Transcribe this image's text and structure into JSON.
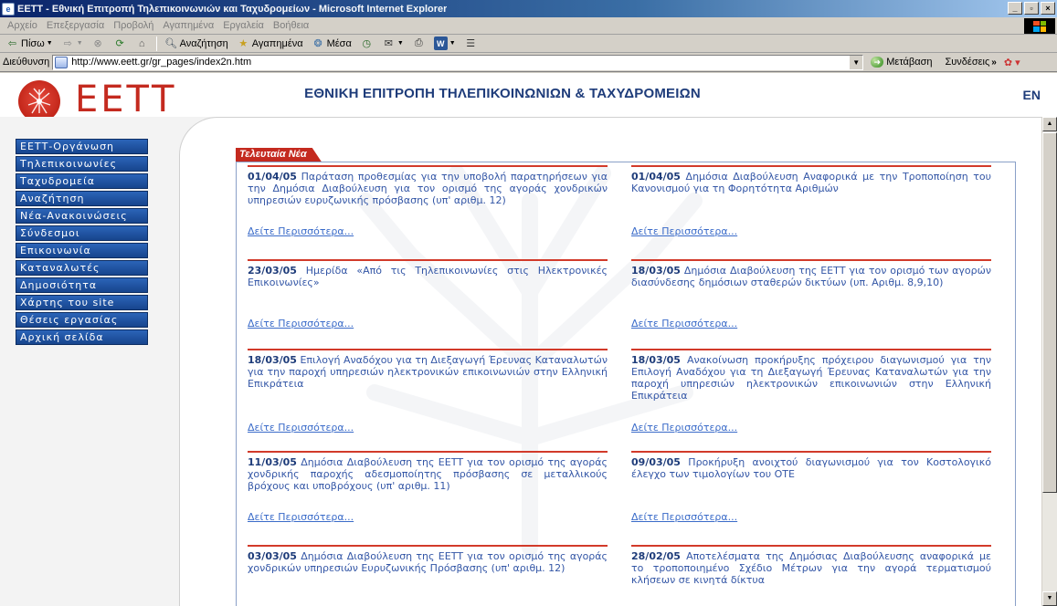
{
  "window": {
    "title": "ΕΕΤΤ - Εθνική Επιτροπή Τηλεπικοινωνιών και Ταχυδρομείων - Microsoft Internet Explorer",
    "buttons": {
      "minimize": "_",
      "maximize": "▫",
      "close": "×"
    }
  },
  "menubar": {
    "items": [
      "Αρχείο",
      "Επεξεργασία",
      "Προβολή",
      "Αγαπημένα",
      "Εργαλεία",
      "Βοήθεια"
    ]
  },
  "toolbar": {
    "back_label": "Πίσω",
    "search_label": "Αναζήτηση",
    "favorites_label": "Αγαπημένα",
    "media_label": "Μέσα"
  },
  "addressbar": {
    "label": "Διεύθυνση",
    "url": "http://www.eett.gr/gr_pages/index2n.htm",
    "go_label": "Μετάβαση",
    "links_label": "Συνδέσεις",
    "links_more": "»"
  },
  "header": {
    "logo_text": "ΕΕΤΤ",
    "title": "ΕΘΝΙΚΗ ΕΠΙΤΡΟΠΗ ΤΗΛΕΠΙΚΟΙΝΩΝΙΩΝ & ΤΑΧΥΔΡΟΜΕΙΩΝ",
    "lang": "EN"
  },
  "sidebar": {
    "items": [
      "ΕΕΤΤ-Οργάνωση",
      "Τηλεπικοινωνίες",
      "Ταχυδρομεία",
      "Αναζήτηση",
      "Νέα-Ανακοινώσεις",
      "Σύνδεσμοι",
      "Επικοινωνία",
      "Καταναλωτές",
      "Δημοσιότητα",
      "Χάρτης του site",
      "Θέσεις εργασίας",
      "Αρχική σελίδα"
    ]
  },
  "news": {
    "heading": "Τελευταία Νέα",
    "more_label": "Δείτε Περισσότερα...",
    "items": [
      {
        "date": "01/04/05",
        "text": "Παράταση προθεσμίας για την υποβολή παρατηρήσεων για την Δημόσια Διαβούλευση για τον ορισμό της αγοράς χονδρικών υπηρεσιών ευρυζωνικής πρόσβασης (υπ' αριθμ. 12)"
      },
      {
        "date": "01/04/05",
        "text": "Δημόσια Διαβούλευση Αναφορικά με την Τροποποίηση του Κανονισμού για τη Φορητότητα Αριθμών"
      },
      {
        "date": "23/03/05",
        "text": "Ημερίδα «Από τις Τηλεπικοινωνίες στις Ηλεκτρονικές Επικοινωνίες»"
      },
      {
        "date": "18/03/05",
        "text": "Δημόσια Διαβούλευση της ΕΕΤΤ για τον ορισμό των αγορών διασύνδεσης δημόσιων σταθερών δικτύων (υπ. Αριθμ. 8,9,10)"
      },
      {
        "date": "18/03/05",
        "text": "Επιλογή Αναδόχου για τη Διεξαγωγή Έρευνας Καταναλωτών για την παροχή υπηρεσιών ηλεκτρονικών επικοινωνιών στην Ελληνική Επικράτεια"
      },
      {
        "date": "18/03/05",
        "text": "Ανακοίνωση προκήρυξης πρόχειρου διαγωνισμού για την Επιλογή Αναδόχου για τη Διεξαγωγή Έρευνας Καταναλωτών για την παροχή υπηρεσιών ηλεκτρονικών επικοινωνιών στην Ελληνική Επικράτεια"
      },
      {
        "date": "11/03/05",
        "text": "Δημόσια Διαβούλευση της ΕΕΤΤ για τον ορισμό της αγοράς χονδρικής παροχής αδεσμοποίητης πρόσβασης σε μεταλλικούς βρόχους και υποβρόχους (υπ' αριθμ. 11)"
      },
      {
        "date": "09/03/05",
        "text": "Προκήρυξη ανοιχτού διαγωνισμού για τον Κοστολογικό έλεγχο των τιμολογίων του ΟΤΕ"
      },
      {
        "date": "03/03/05",
        "text": "Δημόσια Διαβούλευση της ΕΕΤΤ για τον ορισμό της αγοράς χονδρικών υπηρεσιών Ευρυζωνικής Πρόσβασης (υπ' αριθμ. 12)"
      },
      {
        "date": "28/02/05",
        "text": "Αποτελέσματα της Δημόσιας Διαβούλευσης αναφορικά με το τροποποιημένο Σχέδιο Μέτρων για την αγορά τερματισμού κλήσεων σε κινητά δίκτυα"
      }
    ]
  },
  "colors": {
    "accent_red": "#c42a1f",
    "nav_blue": "#17458d",
    "title_blue": "#1e3c7a",
    "link_blue": "#3a6bc9"
  }
}
